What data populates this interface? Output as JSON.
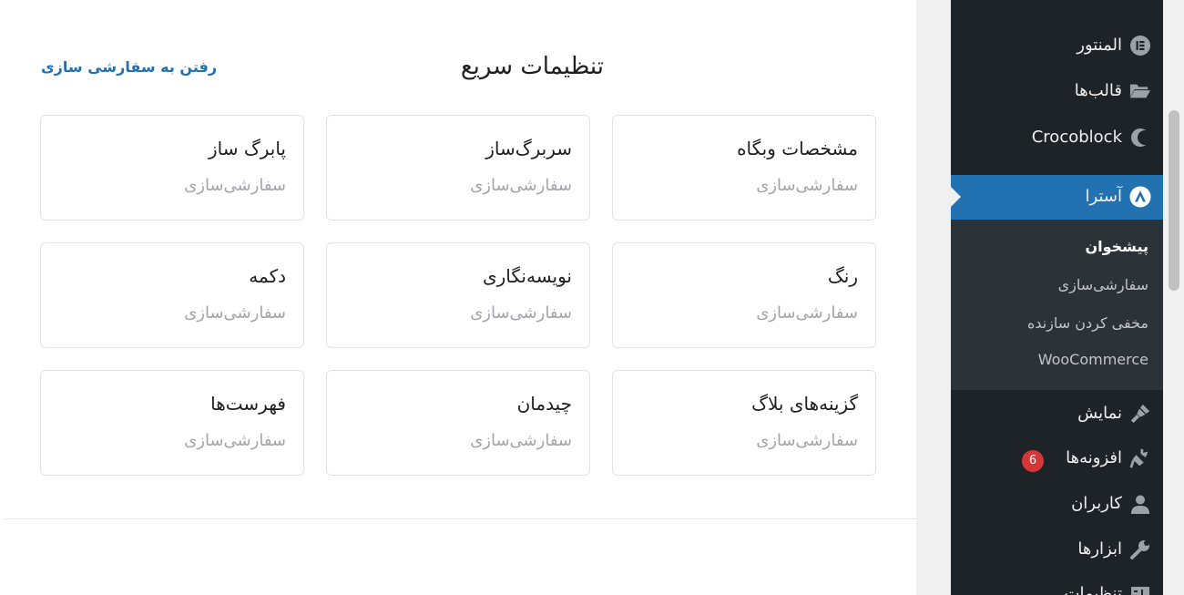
{
  "quick_settings": {
    "title": "تنظیمات سریع",
    "go_to_customizer_link": "رفتن به سفارشی سازی",
    "cards": [
      {
        "title": "مشخصات وبگاه",
        "subtitle": "سفارشی‌سازی"
      },
      {
        "title": "سربرگ‌ساز",
        "subtitle": "سفارشی‌سازی"
      },
      {
        "title": "پابرگ ساز",
        "subtitle": "سفارشی‌سازی"
      },
      {
        "title": "رنگ",
        "subtitle": "سفارشی‌سازی"
      },
      {
        "title": "نویسه‌نگاری",
        "subtitle": "سفارشی‌سازی"
      },
      {
        "title": "دکمه",
        "subtitle": "سفارشی‌سازی"
      },
      {
        "title": "گزینه‌های بلاگ",
        "subtitle": "سفارشی‌سازی"
      },
      {
        "title": "چیدمان",
        "subtitle": "سفارشی‌سازی"
      },
      {
        "title": "فهرست‌ها",
        "subtitle": "سفارشی‌سازی"
      }
    ]
  },
  "sidebar": {
    "items": [
      {
        "label": "المنتور",
        "icon": "elementor-icon"
      },
      {
        "label": "قالب‌ها",
        "icon": "folder-open-icon"
      },
      {
        "label": "Crocoblock",
        "icon": "crocoblock-icon"
      },
      {
        "label": "آسترا",
        "icon": "astra-icon",
        "active": true
      },
      {
        "label": "نمایش",
        "icon": "paintbrush-icon"
      },
      {
        "label": "افزونه‌ها",
        "icon": "plugin-icon",
        "badge": "6"
      },
      {
        "label": "کاربران",
        "icon": "user-icon"
      },
      {
        "label": "ابزارها",
        "icon": "wrench-icon"
      },
      {
        "label": "تنظیمات",
        "icon": "settings-icon"
      }
    ],
    "submenu": [
      {
        "label": "پیشخوان",
        "current": true
      },
      {
        "label": "سفارشی‌سازی"
      },
      {
        "label": "مخفی کردن سازنده"
      },
      {
        "label": "WooCommerce"
      }
    ]
  },
  "colors": {
    "sidebar_bg": "#1d2327",
    "submenu_bg": "#2c3338",
    "accent": "#2271b1",
    "badge": "#d63638"
  }
}
